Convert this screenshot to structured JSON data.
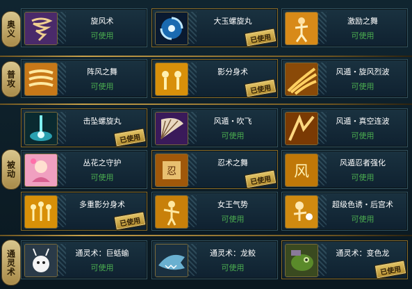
{
  "sections": [
    {
      "label": "奥义"
    },
    {
      "label": "普攻"
    },
    {
      "label": "被动"
    },
    {
      "label": "通灵术"
    }
  ],
  "used_badge": "已使用",
  "skills": [
    {
      "name": "旋风术",
      "status": "可使用",
      "icon": "whirlwind-icon",
      "used": false
    },
    {
      "name": "大玉螺旋丸",
      "status": "",
      "icon": "rasengan-icon",
      "used": true
    },
    {
      "name": "激励之舞",
      "status": "可使用",
      "icon": "dance-icon",
      "used": false
    },
    {
      "name": "阵风之舞",
      "status": "可使用",
      "icon": "gust-icon",
      "used": false
    },
    {
      "name": "影分身术",
      "status": "",
      "icon": "shadow-clone-icon",
      "used": true
    },
    {
      "name": "风遁・旋风烈波",
      "status": "可使用",
      "icon": "wind-wave-icon",
      "used": false
    },
    {
      "name": "击坠螺旋丸",
      "status": "",
      "icon": "falling-rasengan-icon",
      "used": true
    },
    {
      "name": "风遁・吹飞",
      "status": "可使用",
      "icon": "fan-icon",
      "used": false
    },
    {
      "name": "风遁・真空连波",
      "status": "可使用",
      "icon": "vacuum-wave-icon",
      "used": false
    },
    {
      "name": "丛花之守护",
      "status": "可使用",
      "icon": "flower-guard-icon",
      "used": false
    },
    {
      "name": "忍术之舞",
      "status": "",
      "icon": "scroll-icon",
      "used": true
    },
    {
      "name": "风遁忍者强化",
      "status": "可使用",
      "icon": "wind-kanji-icon",
      "used": false
    },
    {
      "name": "多重影分身术",
      "status": "",
      "icon": "multi-clone-icon",
      "used": true
    },
    {
      "name": "女王气势",
      "status": "可使用",
      "icon": "queen-icon",
      "used": false
    },
    {
      "name": "超级色诱・后宫术",
      "status": "可使用",
      "icon": "harem-icon",
      "used": false
    },
    {
      "name": "通灵术：巨蛞蝓",
      "status": "可使用",
      "icon": "slug-icon",
      "used": false
    },
    {
      "name": "通灵术：龙鲛",
      "status": "可使用",
      "icon": "shark-icon",
      "used": false
    },
    {
      "name": "通灵术：变色龙",
      "status": "",
      "icon": "chameleon-icon",
      "used": true
    }
  ]
}
